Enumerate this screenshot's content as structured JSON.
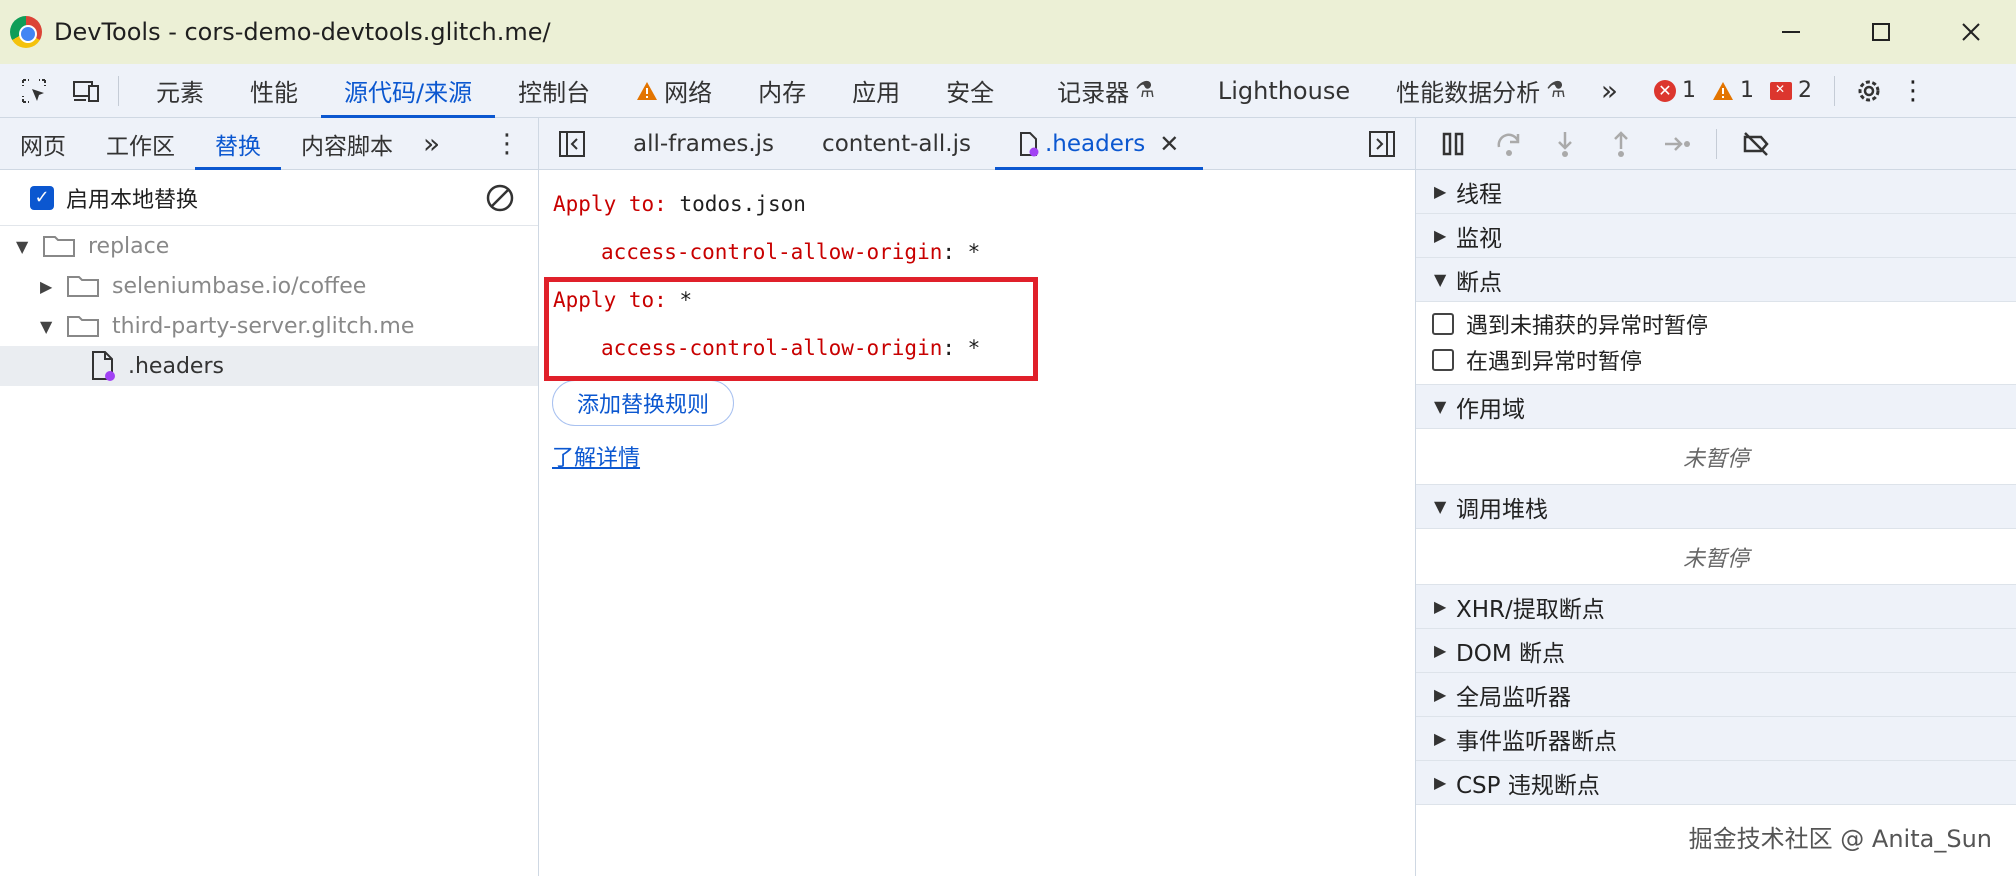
{
  "window": {
    "title": "DevTools - cors-demo-devtools.glitch.me/"
  },
  "toolbar": {
    "tabs": [
      {
        "label": "元素",
        "active": false
      },
      {
        "label": "性能",
        "active": false
      },
      {
        "label": "源代码/来源",
        "active": true
      },
      {
        "label": "控制台",
        "active": false
      },
      {
        "label": "网络",
        "active": false,
        "warning": true
      },
      {
        "label": "内存",
        "active": false
      },
      {
        "label": "应用",
        "active": false
      },
      {
        "label": "安全",
        "active": false
      },
      {
        "label": "记录器",
        "active": false,
        "experimental": true
      },
      {
        "label": "Lighthouse",
        "active": false
      },
      {
        "label": "性能数据分析",
        "active": false,
        "experimental": true
      }
    ],
    "more_label": "»",
    "errors_count": "1",
    "warnings_count": "1",
    "issues_count": "2"
  },
  "left": {
    "tabs": [
      {
        "label": "网页",
        "active": false
      },
      {
        "label": "工作区",
        "active": false
      },
      {
        "label": "替换",
        "active": true
      },
      {
        "label": "内容脚本",
        "active": false
      }
    ],
    "more_label": "»",
    "enable_label": "启用本地替换",
    "enable_checked": true,
    "tree": [
      {
        "label": "replace",
        "level": 0,
        "expanded": true,
        "type": "folder"
      },
      {
        "label": "seleniumbase.io/coffee",
        "level": 1,
        "expanded": false,
        "type": "folder"
      },
      {
        "label": "third-party-server.glitch.me",
        "level": 1,
        "expanded": true,
        "type": "folder"
      },
      {
        "label": ".headers",
        "level": 2,
        "type": "file",
        "selected": true
      }
    ]
  },
  "editor": {
    "tabs": [
      {
        "label": "all-frames.js",
        "active": false
      },
      {
        "label": "content-all.js",
        "active": false
      },
      {
        "label": ".headers",
        "active": true,
        "closable": true
      }
    ],
    "rules": [
      {
        "apply_key": "Apply to",
        "apply_value": "todos.json",
        "header_name": "access-control-allow-origin",
        "header_value": "*"
      },
      {
        "apply_key": "Apply to",
        "apply_value": "*",
        "header_name": "access-control-allow-origin",
        "header_value": "*"
      }
    ],
    "add_rule_label": "添加替换规则",
    "learn_more_label": "了解详情",
    "highlight_color": "#e0202a"
  },
  "debugger": {
    "sections": [
      {
        "label": "线程",
        "expanded": false
      },
      {
        "label": "监视",
        "expanded": false
      },
      {
        "label": "断点",
        "expanded": true
      }
    ],
    "breakpoint_options": [
      {
        "label": "遇到未捕获的异常时暂停",
        "checked": false
      },
      {
        "label": "在遇到异常时暂停",
        "checked": false
      }
    ],
    "scope_label": "作用域",
    "scope_status": "未暂停",
    "callstack_label": "调用堆栈",
    "callstack_status": "未暂停",
    "other_sections": [
      {
        "label": "XHR/提取断点"
      },
      {
        "label": "DOM 断点"
      },
      {
        "label": "全局监听器"
      },
      {
        "label": "事件监听器断点"
      },
      {
        "label": "CSP 违规断点"
      }
    ]
  },
  "watermark": "掘金技术社区 @ Anita_Sun",
  "colors": {
    "accent": "#0b57d0",
    "title_bg": "#ecf0d6",
    "code_keyword": "#c80000"
  }
}
